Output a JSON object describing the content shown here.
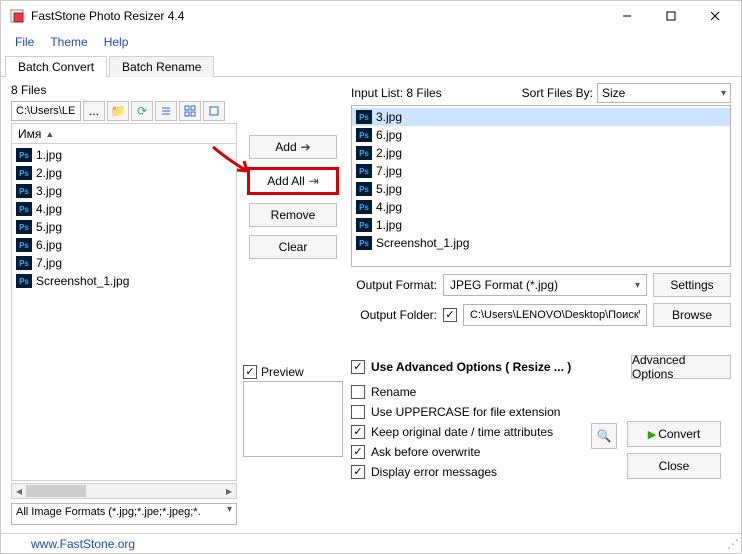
{
  "title": "FastStone Photo Resizer 4.4",
  "menus": [
    "File",
    "Theme",
    "Help"
  ],
  "tabs": [
    "Batch Convert",
    "Batch Rename"
  ],
  "active_tab": 0,
  "file_count_label": "8 Files",
  "path_value": "C:\\Users\\LE",
  "browse_ellipsis": "...",
  "header_label": "Имя",
  "left_files": [
    "1.jpg",
    "2.jpg",
    "3.jpg",
    "4.jpg",
    "5.jpg",
    "6.jpg",
    "7.jpg",
    "Screenshot_1.jpg"
  ],
  "filter_value": "All Image Formats (*.jpg;*.jpe;*.jpeg;*.",
  "mid_buttons": {
    "add": "Add",
    "add_all": "Add All",
    "remove": "Remove",
    "clear": "Clear"
  },
  "preview_label": "Preview",
  "input_list_label": "Input List:  8 Files",
  "sort_label": "Sort Files By:",
  "sort_value": "Size",
  "right_files": [
    "3.jpg",
    "6.jpg",
    "2.jpg",
    "7.jpg",
    "5.jpg",
    "4.jpg",
    "1.jpg",
    "Screenshot_1.jpg"
  ],
  "right_selected": 0,
  "output_format_label": "Output Format:",
  "output_format_value": "JPEG Format (*.jpg)",
  "settings_btn": "Settings",
  "output_folder_label": "Output Folder:",
  "output_folder_value": "C:\\Users\\LENOVO\\Desktop\\Поиск\\Фото маленькие",
  "browse_btn": "Browse",
  "adv_main_label": "Use Advanced Options ( Resize ... )",
  "adv_btn": "Advanced Options",
  "options": [
    {
      "label": "Rename",
      "checked": false
    },
    {
      "label": "Use UPPERCASE for file extension",
      "checked": false
    },
    {
      "label": "Keep original date / time attributes",
      "checked": true
    },
    {
      "label": "Ask before overwrite",
      "checked": true
    },
    {
      "label": "Display error messages",
      "checked": true
    }
  ],
  "convert_btn": "Convert",
  "close_btn": "Close",
  "footer_link": "www.FastStone.org"
}
